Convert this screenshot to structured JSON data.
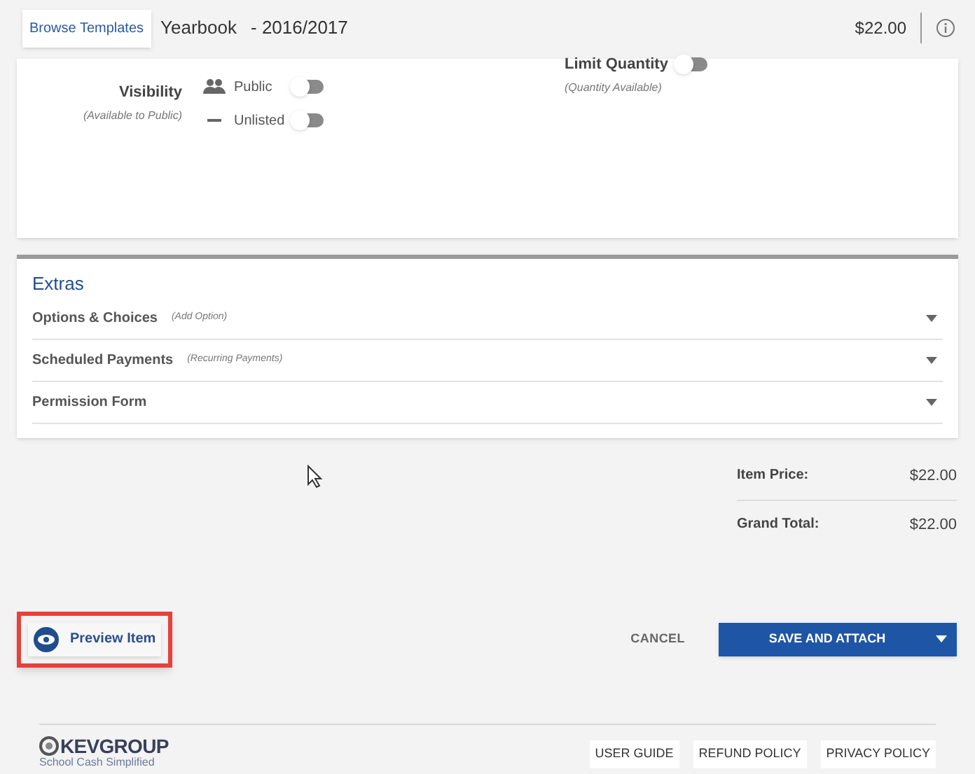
{
  "header": {
    "browse_button": "Browse Templates",
    "title": "Yearbook",
    "year": "- 2016/2017",
    "price": "$22.00"
  },
  "visibility": {
    "label": "Visibility",
    "hint": "(Available to Public)",
    "options": [
      {
        "kind": "people",
        "label": "Public",
        "on": false
      },
      {
        "kind": "dash",
        "label": "Unlisted",
        "on": false
      }
    ]
  },
  "limit_quantity": {
    "label": "Limit Quantity",
    "hint": "(Quantity Available)",
    "on": false
  },
  "extras": {
    "title": "Extras",
    "rows": [
      {
        "label": "Options & Choices",
        "hint": "(Add Option)",
        "expanded": false
      },
      {
        "label": "Scheduled Payments",
        "hint": "(Recurring Payments)",
        "expanded": false
      },
      {
        "label": "Permission Form",
        "expanded": false
      }
    ]
  },
  "totals": [
    {
      "label": "Item Price:",
      "value": "$22.00"
    },
    {
      "label": "Grand Total:",
      "value": "$22.00"
    }
  ],
  "preview_button": "Preview Item",
  "cancel_button": "CANCEL",
  "save_button": "SAVE AND ATTACH",
  "footer": {
    "logo": "KEVGROUP",
    "tagline": "School Cash Simplified",
    "links": [
      "USER GUIDE",
      "REFUND POLICY",
      "PRIVACY POLICY"
    ]
  }
}
